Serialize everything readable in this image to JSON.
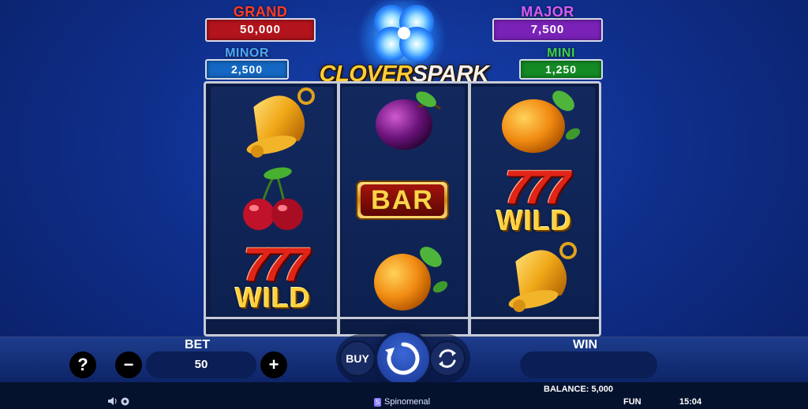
{
  "jackpots": {
    "grand": {
      "title": "GRAND",
      "value": "50,000",
      "title_color": "#ff3b2a",
      "box_color": "#b3141d"
    },
    "major": {
      "title": "MAJOR",
      "value": "7,500",
      "title_color": "#d45bff",
      "box_color": "#7a22b8"
    },
    "minor": {
      "title": "MINOR",
      "value": "2,500",
      "title_color": "#4aa8ff",
      "box_color": "#1467c2"
    },
    "mini": {
      "title": "MINI",
      "value": "1,250",
      "title_color": "#39d24a",
      "box_color": "#138a24"
    }
  },
  "logo": {
    "word1": "CLOVER",
    "word2": "SPARK"
  },
  "reels": [
    [
      "bell",
      "cherries",
      "777-wild"
    ],
    [
      "plum",
      "bar",
      "orange"
    ],
    [
      "orange",
      "777-wild",
      "bell"
    ]
  ],
  "symbols": {
    "wild_label": "WILD",
    "sevens": "777",
    "bar_label": "BAR"
  },
  "controls": {
    "help": "?",
    "minus": "−",
    "plus": "+",
    "bet_label": "BET",
    "bet_value": "50",
    "buy_label": "BUY",
    "win_label": "WIN",
    "win_value": ""
  },
  "status": {
    "balance": "BALANCE: 5,000",
    "brand": "Spinomenal",
    "mode": "FUN",
    "time": "15:04"
  },
  "icons": [
    "sound-icon",
    "settings-icon",
    "spin-icon",
    "autoplay-icon",
    "spinomenal-logo-icon"
  ]
}
